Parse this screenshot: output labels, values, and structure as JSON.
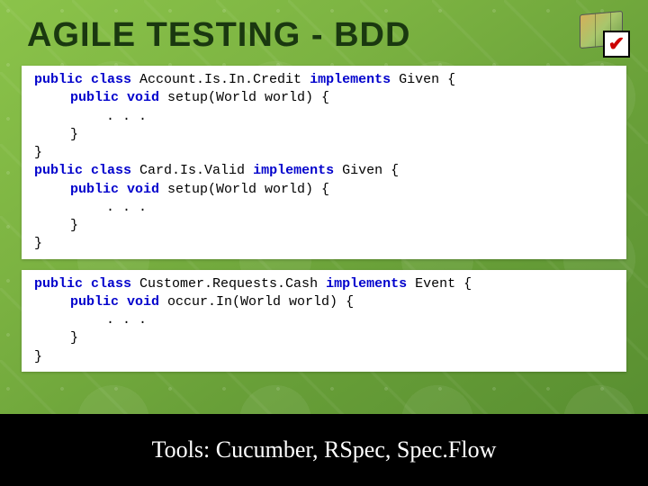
{
  "title": "AGILE TESTING - BDD",
  "code_block_1": {
    "l1": {
      "kw1": "public class",
      "name": " Account.Is.In.Credit ",
      "kw2": "implements",
      "tail": " Given {"
    },
    "l2": {
      "kw": "public void",
      "tail": " setup(World world) {",
      "indent": 1
    },
    "l3": {
      "text": ". . .",
      "indent": 2
    },
    "l4": {
      "text": "}",
      "indent": 1
    },
    "l5": {
      "text": "}"
    },
    "l6": {
      "kw1": "public class",
      "name": " Card.Is.Valid ",
      "kw2": "implements",
      "tail": " Given {"
    },
    "l7": {
      "kw": "public void",
      "tail": " setup(World world) {",
      "indent": 1
    },
    "l8": {
      "text": ". . .",
      "indent": 2
    },
    "l9": {
      "text": "}",
      "indent": 1
    },
    "l10": {
      "text": "}"
    }
  },
  "code_block_2": {
    "l1": {
      "kw1": "public class",
      "name": " Customer.Requests.Cash ",
      "kw2": "implements",
      "tail": " Event {"
    },
    "l2": {
      "kw": "public void",
      "tail": " occur.In(World world) {",
      "indent": 1
    },
    "l3": {
      "text": ". . .",
      "indent": 2
    },
    "l4": {
      "text": "}",
      "indent": 1
    },
    "l5": {
      "text": "}"
    }
  },
  "footer": "Tools: Cucumber, RSpec, Spec.Flow",
  "icon": {
    "map": "map-icon",
    "check": "✔"
  }
}
